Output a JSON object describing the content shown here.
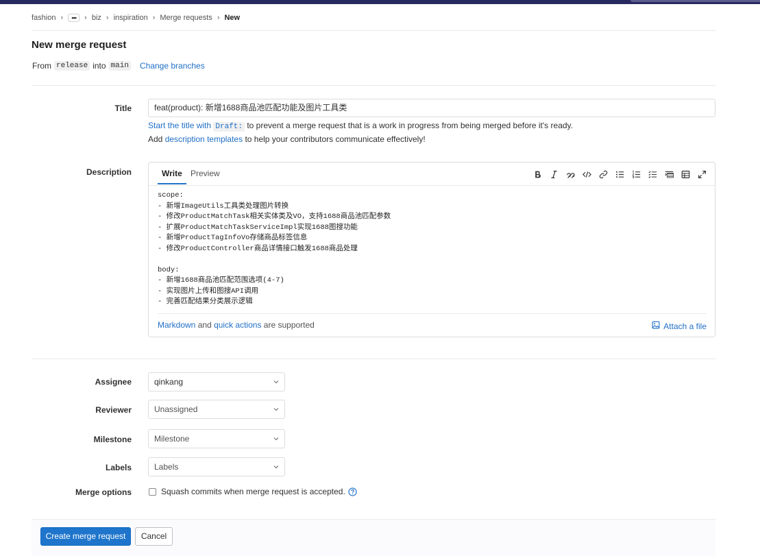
{
  "breadcrumb": {
    "items": [
      "fashion",
      "biz",
      "inspiration",
      "Merge requests"
    ],
    "current": "New",
    "collapsed": "•••"
  },
  "page": {
    "title": "New merge request",
    "from_label": "From",
    "source_branch": "release",
    "into_label": "into",
    "target_branch": "main",
    "change_branches": "Change branches"
  },
  "form": {
    "title_label": "Title",
    "title_value": "feat(product): 新增1688商品池匹配功能及图片工具类",
    "hint_start": "Start the title with",
    "hint_draft": "Draft:",
    "hint_rest": "to prevent a merge request that is a work in progress from being merged before it's ready.",
    "hint_add": "Add",
    "hint_templates": "description templates",
    "hint_templates_rest": "to help your contributors communicate effectively!",
    "description_label": "Description",
    "tab_write": "Write",
    "tab_preview": "Preview",
    "description_value": "scope:\n- 新增ImageUtils工具类处理图片转换\n- 修改ProductMatchTask相关实体类及VO，支持1688商品池匹配参数\n- 扩展ProductMatchTaskServiceImpl实现1688图搜功能\n- 新增ProductTagInfoVo存储商品标签信息\n- 修改ProductController商品详情接口触发1688商品处理\n\nbody:\n- 新增1688商品池匹配范围选项(4-7)\n- 实现图片上传和图搜API调用\n- 完善匹配结果分类展示逻辑",
    "markdown": "Markdown",
    "and": "and",
    "quick_actions": "quick actions",
    "supported": "are supported",
    "attach_file": "Attach a file",
    "assignee_label": "Assignee",
    "assignee_value": "qinkang",
    "reviewer_label": "Reviewer",
    "reviewer_value": "Unassigned",
    "milestone_label": "Milestone",
    "milestone_value": "Milestone",
    "labels_label": "Labels",
    "labels_value": "Labels",
    "merge_options_label": "Merge options",
    "squash_label": "Squash commits when merge request is accepted."
  },
  "actions": {
    "create": "Create merge request",
    "cancel": "Cancel"
  },
  "colors": {
    "accent": "#1f75cb",
    "link": "#1f6fc5",
    "topbar": "#292961"
  }
}
